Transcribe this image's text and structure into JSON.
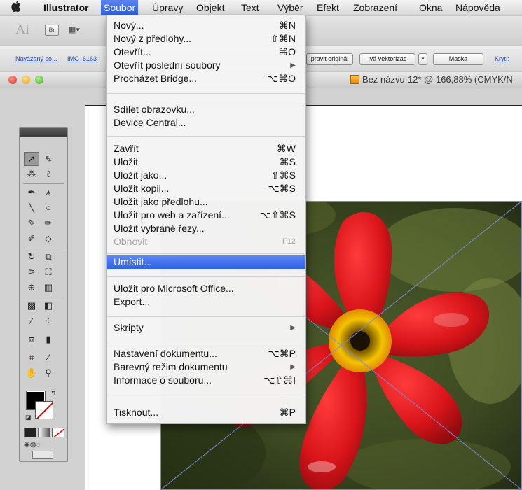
{
  "menubar": {
    "apple": "",
    "items": [
      "Illustrator",
      "Soubor",
      "Úpravy",
      "Objekt",
      "Text",
      "Výběr",
      "Efekt",
      "Zobrazení",
      "Okna",
      "Nápověda"
    ]
  },
  "appbar": {
    "ai_logo": "Ai",
    "br_label": "Br"
  },
  "control_bar": {
    "linked_file": "Navázaný so...",
    "file_name": "IMG_6163",
    "edit_original": "pravit originál",
    "live_trace": "ivá vektorizac",
    "mask": "Maska",
    "opacity": "Krytí:"
  },
  "document": {
    "title": "Bez názvu-12* @ 166,88% (CMYK/N"
  },
  "menu": {
    "new": {
      "label": "Nový...",
      "shortcut": "⌘N"
    },
    "new_from_template": {
      "label": "Nový z předlohy...",
      "shortcut": "⇧⌘N"
    },
    "open": {
      "label": "Otevřít...",
      "shortcut": "⌘O"
    },
    "open_recent": {
      "label": "Otevřít poslední soubory"
    },
    "browse_bridge": {
      "label": "Procházet Bridge...",
      "shortcut": "⌥⌘O"
    },
    "share_screen": {
      "label": "Sdílet obrazovku..."
    },
    "device_central": {
      "label": "Device Central..."
    },
    "close": {
      "label": "Zavřít",
      "shortcut": "⌘W"
    },
    "save": {
      "label": "Uložit",
      "shortcut": "⌘S"
    },
    "save_as": {
      "label": "Uložit jako...",
      "shortcut": "⇧⌘S"
    },
    "save_copy": {
      "label": "Uložit kopii...",
      "shortcut": "⌥⌘S"
    },
    "save_template": {
      "label": "Uložit jako předlohu..."
    },
    "save_web": {
      "label": "Uložit pro web a zařízení...",
      "shortcut": "⌥⇧⌘S"
    },
    "save_slices": {
      "label": "Uložit vybrané řezy..."
    },
    "revert": {
      "label": "Obnovit",
      "shortcut": "F12"
    },
    "place": {
      "label": "Umístit..."
    },
    "save_office": {
      "label": "Uložit pro Microsoft Office..."
    },
    "export": {
      "label": "Export..."
    },
    "scripts": {
      "label": "Skripty"
    },
    "doc_setup": {
      "label": "Nastavení dokumentu...",
      "shortcut": "⌥⌘P"
    },
    "color_mode": {
      "label": "Barevný režim dokumentu"
    },
    "file_info": {
      "label": "Informace o souboru...",
      "shortcut": "⌥⇧⌘I"
    },
    "print": {
      "label": "Tisknout...",
      "shortcut": "⌘P"
    }
  },
  "colors": {
    "menu_highlight": "#2f5fe0",
    "flower_red": "#d9151a",
    "flower_center": "#f3c300"
  }
}
